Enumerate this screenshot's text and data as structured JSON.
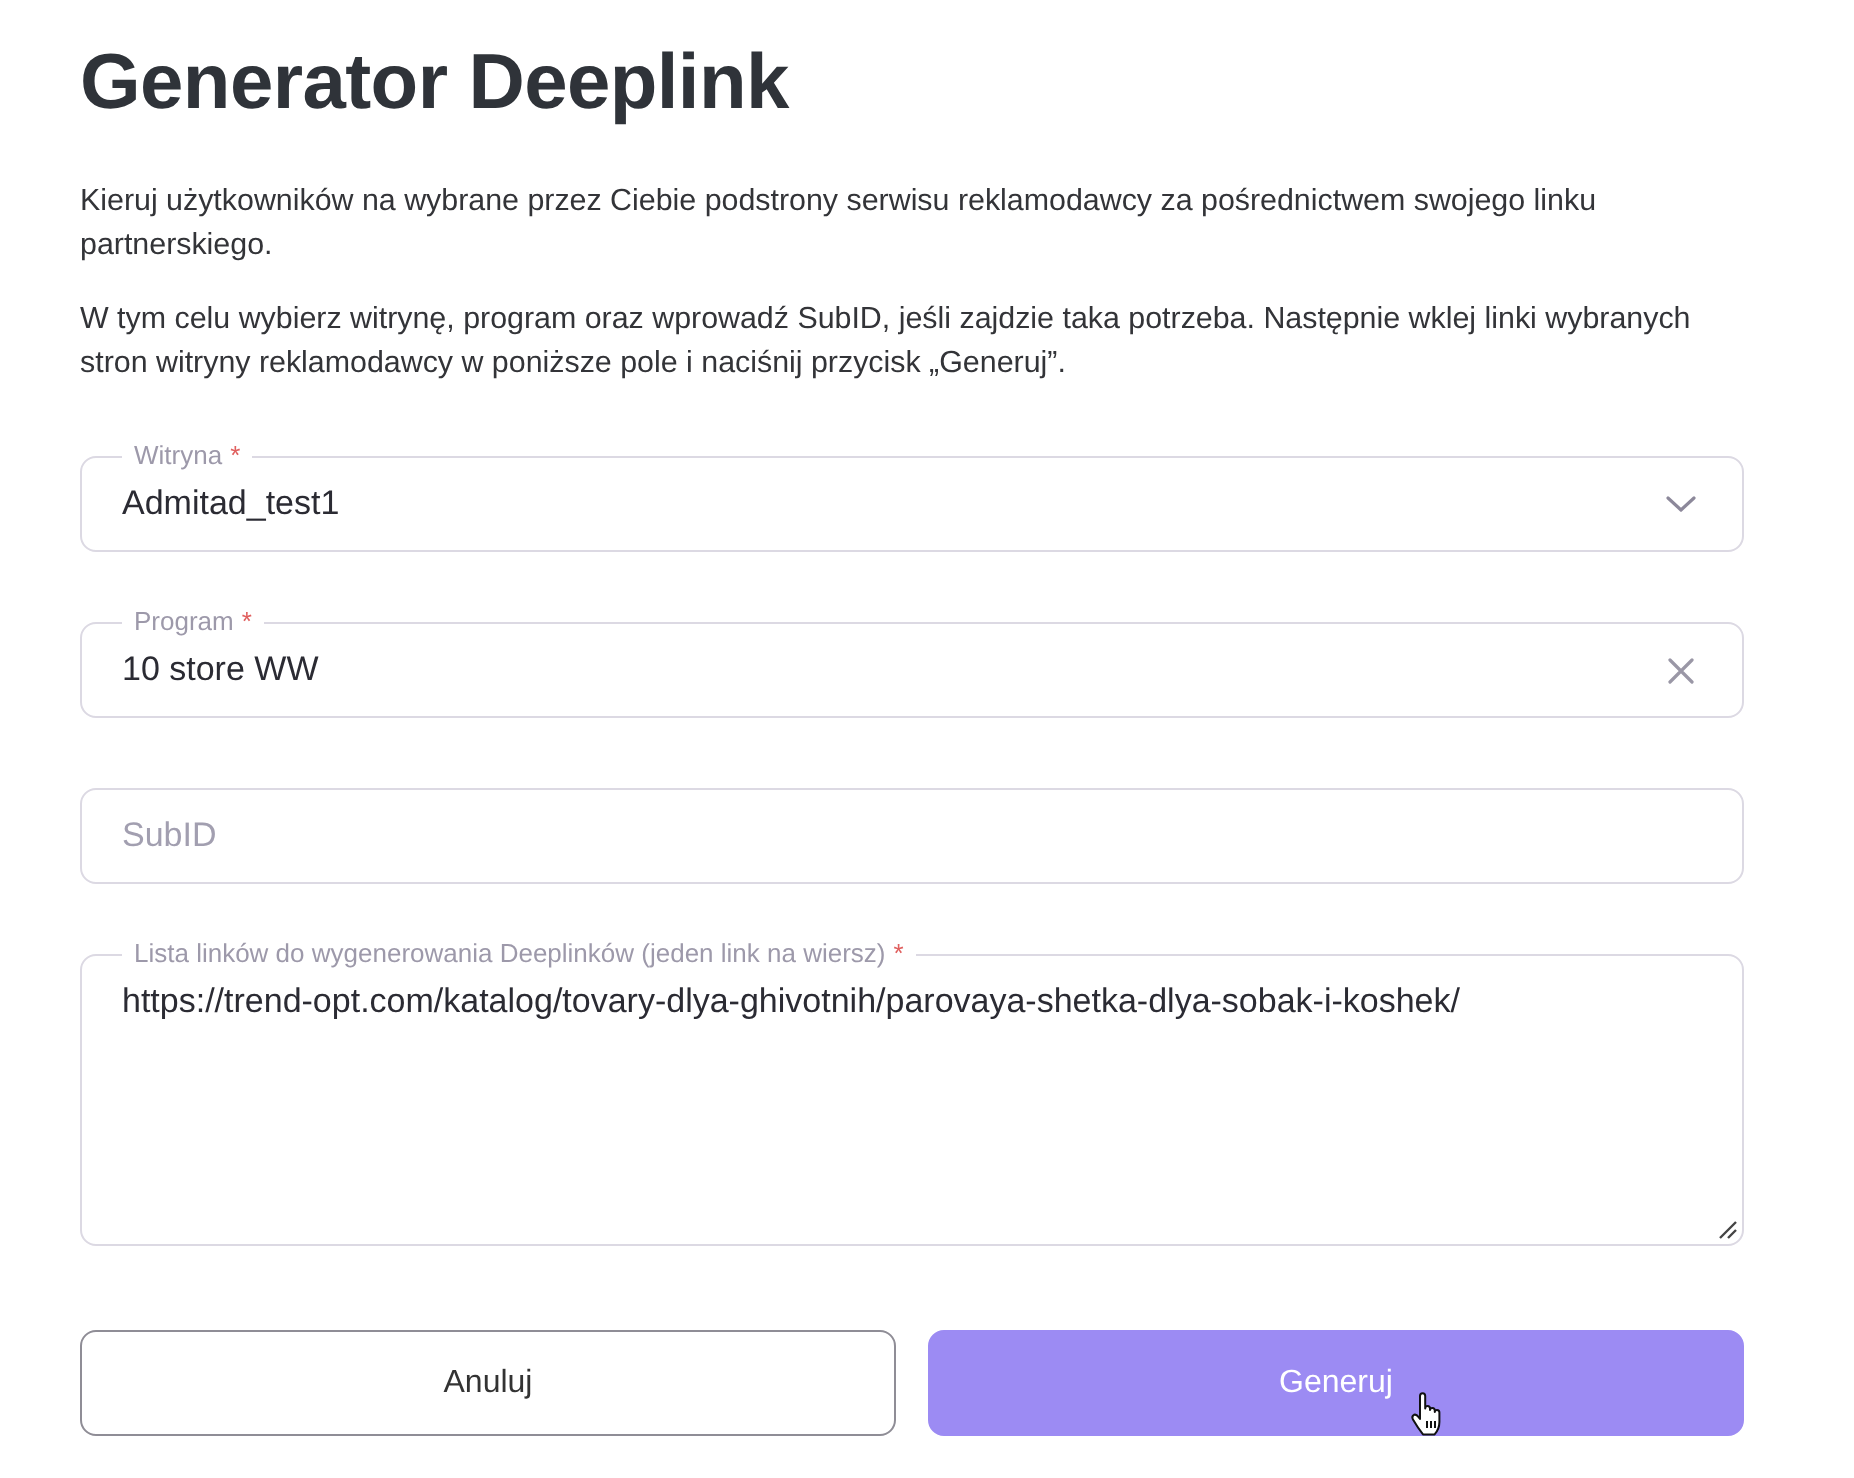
{
  "title": "Generator Deeplink",
  "intro": [
    "Kieruj użytkowników na wybrane przez Ciebie podstrony serwisu reklamodawcy za pośrednictwem swojego linku partnerskiego.",
    "W tym celu wybierz witrynę, program oraz wprowadź SubID, jeśli zajdzie taka potrzeba. Następnie wklej linki wybranych stron witryny reklamodawcy w poniższe pole i naciśnij przycisk „Generuj”."
  ],
  "required_mark": "*",
  "fields": [
    {
      "kind": "select",
      "label": "Witryna",
      "required": true,
      "value": "Admitad_test1"
    },
    {
      "kind": "combo",
      "label": "Program",
      "required": true,
      "value": "10 store WW"
    },
    {
      "kind": "input",
      "placeholder": "SubID",
      "required": false
    },
    {
      "kind": "textarea",
      "label": "Lista linków do wygenerowania Deeplinków (jeden link na wiersz)",
      "required": true,
      "value": "https://trend-opt.com/katalog/tovary-dlya-ghivotnih/parovaya-shetka-dlya-sobak-i-koshek/"
    }
  ],
  "buttons": [
    {
      "kind": "secondary",
      "label": "Anuluj"
    },
    {
      "kind": "primary",
      "label": "Generuj"
    }
  ]
}
